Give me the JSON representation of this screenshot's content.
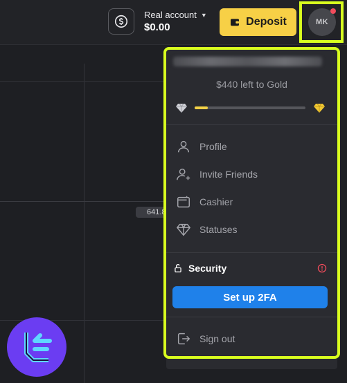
{
  "header": {
    "account_title": "Real account",
    "account_balance": "$0.00",
    "deposit_label": "Deposit",
    "avatar_initials": "MK",
    "notification_color": "#f24c5c",
    "deposit_color": "#f7d046",
    "highlight_color": "#d8ff1f"
  },
  "chart": {
    "price_label": "641.8"
  },
  "menu": {
    "progress_text": "$440 left to Gold",
    "progress_fraction": 0.12,
    "items": [
      {
        "label": "Profile",
        "icon": "user-icon"
      },
      {
        "label": "Invite Friends",
        "icon": "user-plus-icon"
      },
      {
        "label": "Cashier",
        "icon": "wallet-icon"
      },
      {
        "label": "Statuses",
        "icon": "diamond-icon"
      }
    ],
    "security_label": "Security",
    "twofa_label": "Set up 2FA",
    "signout_label": "Sign out",
    "accent_blue": "#1f81ea"
  }
}
